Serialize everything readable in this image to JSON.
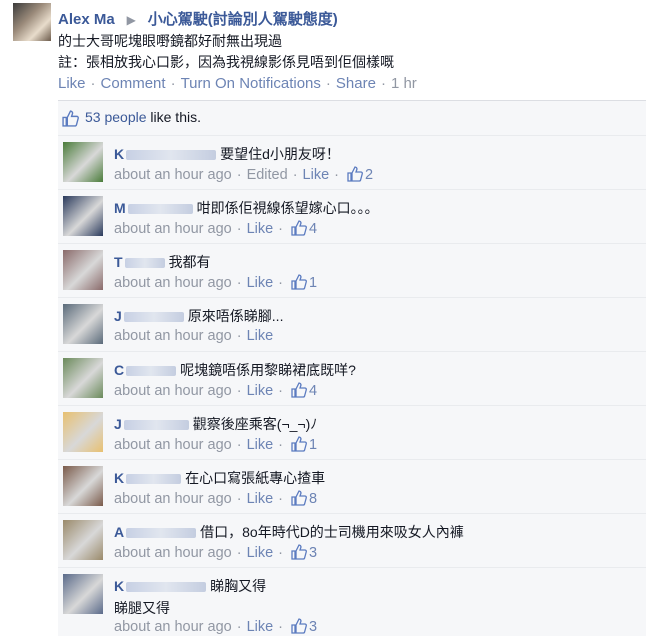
{
  "post": {
    "author": "Alex Ma",
    "group": "小心駕駛(討論別人駕駛態度)",
    "body_line1": "的士大哥呢塊眼嘢鏡都好耐無出現過",
    "body_line2": "註：張相放我心口影，因為我視線影係見唔到佢個樣嘅",
    "actions": {
      "like": "Like",
      "comment": "Comment",
      "notifications": "Turn On Notifications",
      "share": "Share",
      "time": "1 hr"
    }
  },
  "likes": {
    "people": "53 people",
    "suffix": "like this."
  },
  "comments": [
    {
      "name": "K",
      "text": "要望住d小朋友呀！",
      "time": "about an hour ago",
      "edited": "Edited",
      "like": "Like",
      "count": "2",
      "avatar": "#4a7c3a"
    },
    {
      "name": "M",
      "text": "咁即係佢視線係望嫁心口。。。",
      "time": "about an hour ago",
      "like": "Like",
      "count": "4",
      "avatar": "#2a3a5c"
    },
    {
      "name": "T",
      "text": "我都有",
      "time": "about an hour ago",
      "like": "Like",
      "count": "1",
      "avatar": "#8a6a6a"
    },
    {
      "name": "J",
      "text": "原來唔係睇腳...",
      "time": "about an hour ago",
      "like": "Like",
      "count": "",
      "avatar": "#5a6a7a"
    },
    {
      "name": "C",
      "text": "呢塊鏡唔係用黎睇裙底既咩?",
      "time": "about an hour ago",
      "like": "Like",
      "count": "4",
      "avatar": "#6a8a5a"
    },
    {
      "name": "J",
      "text": "觀察後座乘客(¬_¬)ﾉ",
      "time": "about an hour ago",
      "like": "Like",
      "count": "1",
      "avatar": "#e8c070"
    },
    {
      "name": "K",
      "text": "在心口寫張紙專心揸車",
      "time": "about an hour ago",
      "like": "Like",
      "count": "8",
      "avatar": "#7a5a4a"
    },
    {
      "name": "A",
      "text": "借口，8o年時代D的士司機用來吸女人內褲",
      "time": "about an hour ago",
      "like": "Like",
      "count": "3",
      "avatar": "#9a8a6a"
    },
    {
      "name": "K",
      "text": "睇胸又得",
      "text2": "睇腿又得",
      "time": "about an hour ago",
      "like": "Like",
      "count": "3",
      "avatar": "#5a6a8a"
    }
  ],
  "colors": {
    "link": "#3b5998",
    "meta": "#9197a3",
    "bg": "#f6f7f9"
  }
}
